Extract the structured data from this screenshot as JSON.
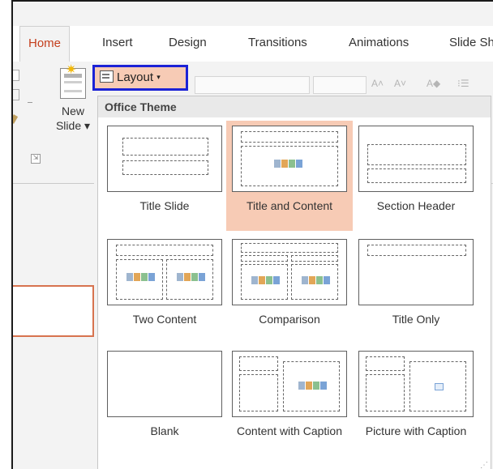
{
  "tabs": [
    {
      "label": "Home",
      "active": true
    },
    {
      "label": "Insert",
      "active": false
    },
    {
      "label": "Design",
      "active": false
    },
    {
      "label": "Transitions",
      "active": false
    },
    {
      "label": "Animations",
      "active": false
    },
    {
      "label": "Slide Sh",
      "active": false
    }
  ],
  "ribbon": {
    "new_slide_line1": "New",
    "new_slide_line2": "Slide ▾",
    "layout_label": "Layout",
    "layout_caret": "▾"
  },
  "dropdown": {
    "header": "Office Theme",
    "layouts": [
      {
        "label": "Title Slide",
        "selected": false
      },
      {
        "label": "Title and Content",
        "selected": true
      },
      {
        "label": "Section Header",
        "selected": false
      },
      {
        "label": "Two Content",
        "selected": false
      },
      {
        "label": "Comparison",
        "selected": false
      },
      {
        "label": "Title Only",
        "selected": false
      },
      {
        "label": "Blank",
        "selected": false
      },
      {
        "label": "Content with Caption",
        "selected": false
      },
      {
        "label": "Picture with Caption",
        "selected": false
      }
    ]
  },
  "colors": {
    "accent": "#c43e1c",
    "highlight": "#f7cbb5",
    "focus_outline": "#1c22d6"
  }
}
